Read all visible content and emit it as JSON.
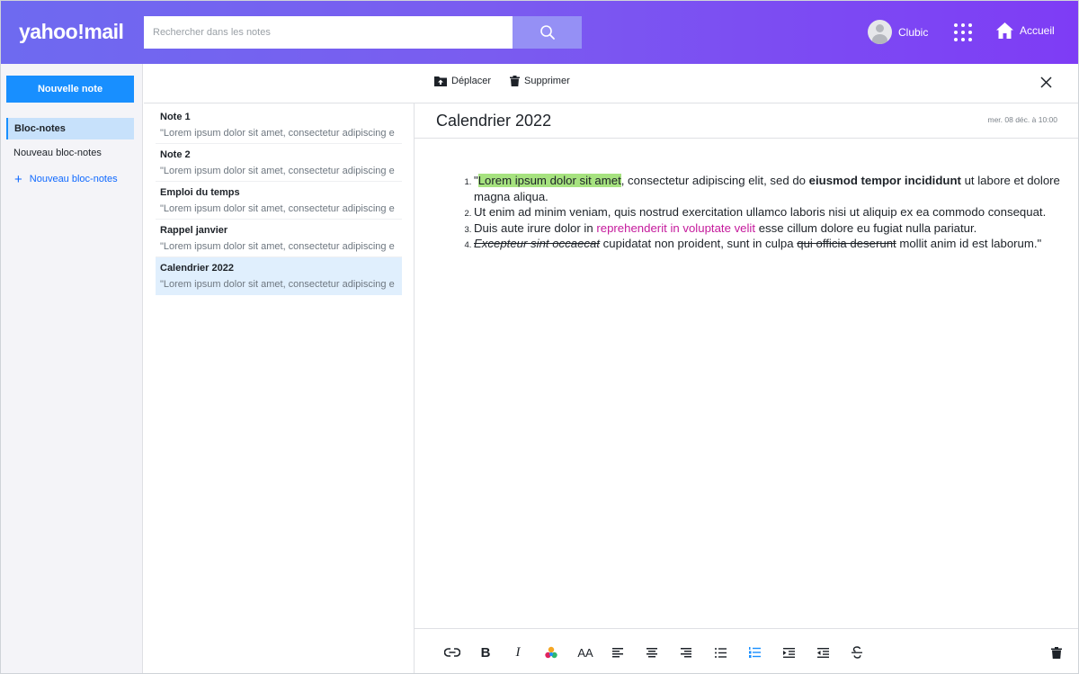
{
  "header": {
    "logo": "yahoo!mail",
    "search": {
      "placeholder": "Rechercher dans les notes"
    },
    "user_name": "Clubic",
    "home_label": "Accueil",
    "gradient": [
      "#6e6af0",
      "#7e3cf5"
    ]
  },
  "sidebar": {
    "new_note_label": "Nouvelle note",
    "notebooks": [
      {
        "label": "Bloc-notes",
        "selected": true
      },
      {
        "label": "Nouveau bloc-notes",
        "selected": false
      }
    ],
    "add_notebook_label": "Nouveau bloc-notes"
  },
  "toolbar": {
    "move_label": "Déplacer",
    "delete_label": "Supprimer"
  },
  "notes": [
    {
      "title": "Note 1",
      "snippet": "\"Lorem ipsum dolor sit amet, consectetur adipiscing e"
    },
    {
      "title": "Note 2",
      "snippet": "\"Lorem ipsum dolor sit amet, consectetur adipiscing e"
    },
    {
      "title": "Emploi du temps",
      "snippet": "\"Lorem ipsum dolor sit amet, consectetur adipiscing e"
    },
    {
      "title": "Rappel janvier",
      "snippet": "\"Lorem ipsum dolor sit amet, consectetur adipiscing e"
    },
    {
      "title": "Calendrier 2022",
      "snippet": "\"Lorem ipsum dolor sit amet, consectetur adipiscing e",
      "selected": true
    }
  ],
  "editor": {
    "title": "Calendrier 2022",
    "date": "mer. 08 déc. à 10:00",
    "items": [
      {
        "quote_open": "\"",
        "highlight": "Lorem ipsum dolor sit amet",
        "text_a": ", consectetur adipiscing elit, sed do ",
        "bold": "eiusmod tempor incididunt",
        "text_b": " ut labore et dolore magna aliqua."
      },
      {
        "text": "Ut enim ad minim veniam, quis nostrud exercitation ullamco laboris nisi ut aliquip ex ea commodo consequat."
      },
      {
        "text_a": "Duis aute irure dolor in ",
        "colored": "reprehenderit in voluptate velit",
        "text_b": " esse cillum dolore eu fugiat nulla pariatur."
      },
      {
        "strike_italic": "Excepteur sint occaecat",
        "text_a": " cupidatat non proident, sunt in culpa ",
        "strike": "qui officia deserunt",
        "text_b": " mollit anim id est laborum.\""
      }
    ],
    "colors": {
      "highlight": "#a6e27f",
      "pink": "#c51a9c"
    }
  },
  "format_toolbar": {
    "icons": [
      "link-icon",
      "bold-icon",
      "italic-icon",
      "text-color-icon",
      "font-size-icon",
      "align-left-icon",
      "align-center-icon",
      "align-right-icon",
      "bullet-list-icon",
      "numbered-list-icon",
      "indent-icon",
      "outdent-icon",
      "strikethrough-icon",
      "trash-icon"
    ]
  }
}
